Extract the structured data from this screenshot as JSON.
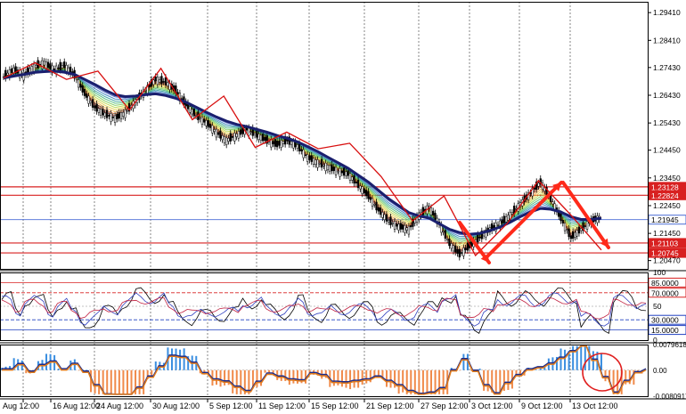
{
  "chart_data": [
    {
      "type": "line",
      "panel": "price",
      "series": [],
      "y_ticks": [
        "1.29410",
        "1.28410",
        "1.27430",
        "1.26430",
        "1.25430",
        "1.24450",
        "1.23450",
        "1.22450",
        "1.21450",
        "1.20470"
      ],
      "ylim": [
        1.2017,
        1.298
      ],
      "x_ticks": [
        "Aug 12:00",
        "16 Aug 12:00",
        "24 Aug 12:00",
        "30 Aug 12:00",
        "5 Sep 12:00",
        "11 Sep 12:00",
        "15 Sep 12:00",
        "21 Sep 12:00",
        "27 Sep 12:00",
        "3 Oct 12:00",
        "9 Oct 12:00",
        "13 Oct 12:00"
      ],
      "price_levels": [
        {
          "label": "1.23128",
          "value": 1.23128,
          "color": "#d82020"
        },
        {
          "label": "1.22824",
          "value": 1.22824,
          "color": "#d82020"
        },
        {
          "label": "1.21945",
          "value": 1.21945,
          "color": "#4a6cd6"
        },
        {
          "label": "1.21103",
          "value": 1.21103,
          "color": "#d82020"
        },
        {
          "label": "1.20745",
          "value": 1.20745,
          "color": "#d82020"
        }
      ],
      "price_path": [
        1.271,
        1.2735,
        1.2715,
        1.2745,
        1.276,
        1.2735,
        1.275,
        1.2715,
        1.265,
        1.26,
        1.2575,
        1.256,
        1.258,
        1.262,
        1.266,
        1.27,
        1.269,
        1.266,
        1.261,
        1.257,
        1.2545,
        1.251,
        1.248,
        1.25,
        1.252,
        1.25,
        1.248,
        1.2465,
        1.248,
        1.246,
        1.242,
        1.24,
        1.2385,
        1.237,
        1.236,
        1.232,
        1.228,
        1.223,
        1.219,
        1.217,
        1.216,
        1.221,
        1.224,
        1.218,
        1.211,
        1.207,
        1.21,
        1.213,
        1.216,
        1.218,
        1.221,
        1.225,
        1.229,
        1.233,
        1.227,
        1.22,
        1.213,
        1.216,
        1.219,
        1.2205
      ],
      "ma_path": [
        1.2705,
        1.2712,
        1.2718,
        1.2725,
        1.2728,
        1.273,
        1.2726,
        1.2718,
        1.27,
        1.2682,
        1.2662,
        1.2645,
        1.2638,
        1.264,
        1.2645,
        1.2648,
        1.2642,
        1.2632,
        1.2618,
        1.26,
        1.2582,
        1.2565,
        1.255,
        1.2538,
        1.253,
        1.252,
        1.251,
        1.2498,
        1.2488,
        1.2475,
        1.2458,
        1.244,
        1.242,
        1.24,
        1.238,
        1.2355,
        1.233,
        1.23,
        1.227,
        1.2245,
        1.222,
        1.2208,
        1.22,
        1.218,
        1.216,
        1.2148,
        1.2142,
        1.2145,
        1.2155,
        1.2168,
        1.2185,
        1.2205,
        1.2222,
        1.2235,
        1.2232,
        1.2222,
        1.2205,
        1.2195,
        1.2195,
        1.22
      ],
      "zigzag": [
        1.2705,
        1.276,
        1.27,
        1.273,
        1.259,
        1.274,
        1.2555,
        1.264,
        1.2455,
        1.251,
        1.245,
        1.247,
        1.235,
        1.219,
        1.228,
        1.2065,
        1.218,
        1.2335,
        1.2215,
        1.2085
      ]
    },
    {
      "type": "line",
      "panel": "oscillator",
      "ylim": [
        0,
        100
      ],
      "y_ticks": [
        "100",
        "50",
        "0"
      ],
      "levels": [
        {
          "label": "85.0000",
          "value": 85,
          "color": "#d82020"
        },
        {
          "label": "70.0000",
          "value": 70,
          "color": "#d82020"
        },
        {
          "label": "30.0000",
          "value": 30,
          "color": "#2040c0"
        },
        {
          "label": "15.0000",
          "value": 15,
          "color": "#2040c0"
        }
      ]
    },
    {
      "type": "bar",
      "panel": "histogram",
      "y_ticks": [
        "0.0079618",
        "0.00",
        "-0.0080917"
      ],
      "ylim": [
        -0.0080917,
        0.0079618
      ]
    }
  ]
}
